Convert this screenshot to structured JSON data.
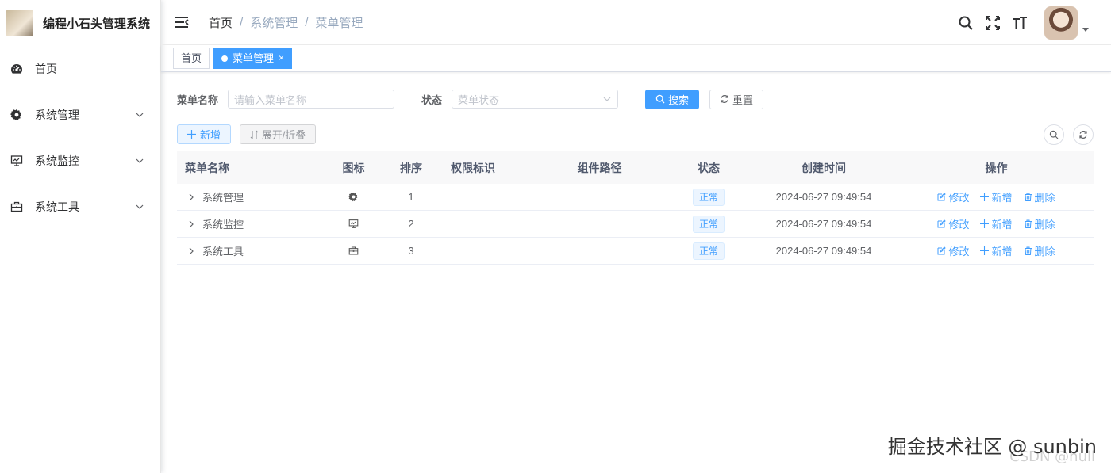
{
  "app": {
    "title": "编程小石头管理系统"
  },
  "sidebar": {
    "items": [
      {
        "label": "首页",
        "icon": "dashboard-icon",
        "expandable": false
      },
      {
        "label": "系统管理",
        "icon": "gear-icon",
        "expandable": true
      },
      {
        "label": "系统监控",
        "icon": "monitor-icon",
        "expandable": true
      },
      {
        "label": "系统工具",
        "icon": "toolbox-icon",
        "expandable": true
      }
    ]
  },
  "navbar": {
    "breadcrumb": [
      "首页",
      "系统管理",
      "菜单管理"
    ],
    "separator": "/",
    "icons": [
      "search-icon",
      "fullscreen-icon",
      "font-size-icon"
    ]
  },
  "tags": [
    {
      "label": "首页",
      "active": false
    },
    {
      "label": "菜单管理",
      "active": true,
      "close": "×"
    }
  ],
  "search": {
    "menu_name_label": "菜单名称",
    "menu_name_placeholder": "请输入菜单名称",
    "status_label": "状态",
    "status_placeholder": "菜单状态",
    "search_button": "搜索",
    "reset_button": "重置"
  },
  "toolbar": {
    "add_button": "新增",
    "expand_button": "展开/折叠"
  },
  "table": {
    "columns": [
      "菜单名称",
      "图标",
      "排序",
      "权限标识",
      "组件路径",
      "状态",
      "创建时间",
      "操作"
    ],
    "rows": [
      {
        "name": "系统管理",
        "icon": "gear-icon",
        "order": "1",
        "perms": "",
        "component": "",
        "status": "正常",
        "created": "2024-06-27 09:49:54"
      },
      {
        "name": "系统监控",
        "icon": "monitor-icon",
        "order": "2",
        "perms": "",
        "component": "",
        "status": "正常",
        "created": "2024-06-27 09:49:54"
      },
      {
        "name": "系统工具",
        "icon": "toolbox-icon",
        "order": "3",
        "perms": "",
        "component": "",
        "status": "正常",
        "created": "2024-06-27 09:49:54"
      }
    ],
    "actions": {
      "edit": "修改",
      "add": "新增",
      "delete": "删除"
    }
  },
  "watermark": {
    "main": "掘金技术社区 @ sunbin",
    "sub": "CSDN @null"
  },
  "colors": {
    "primary": "#409eff",
    "text": "#303133",
    "muted": "#97a8be",
    "border": "#dcdfe6"
  }
}
